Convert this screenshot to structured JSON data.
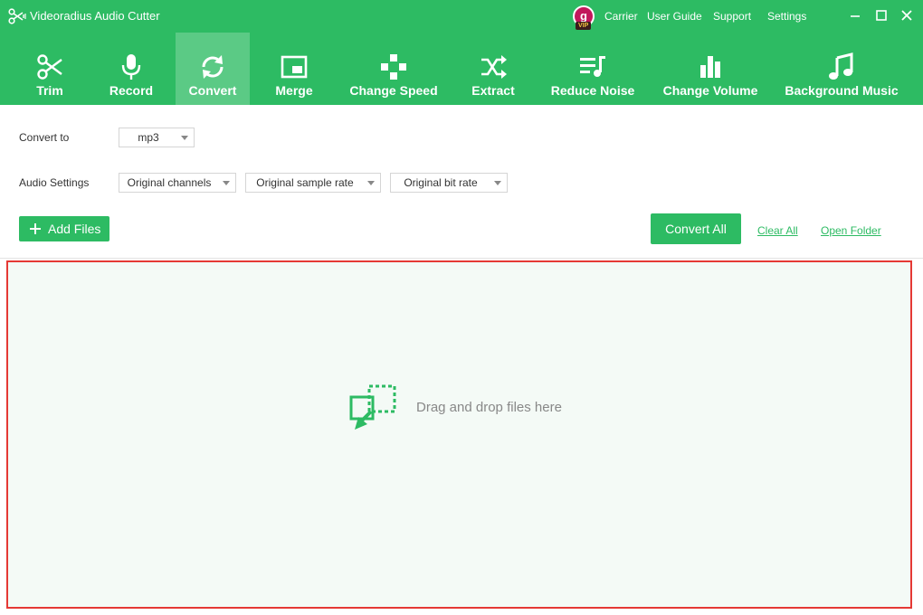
{
  "app": {
    "title": "Videoradius Audio Cutter"
  },
  "user": {
    "avatar_letter": "g",
    "badge": "VIP"
  },
  "top_links": [
    "Carrier",
    "User Guide",
    "Support",
    "Settings"
  ],
  "toolbar": {
    "items": [
      {
        "label": "Trim",
        "icon": "scissors-icon",
        "active": false
      },
      {
        "label": "Record",
        "icon": "microphone-icon",
        "active": false
      },
      {
        "label": "Convert",
        "icon": "convert-icon",
        "active": true
      },
      {
        "label": "Merge",
        "icon": "merge-icon",
        "active": false
      },
      {
        "label": "Change Speed",
        "icon": "speed-icon",
        "active": false
      },
      {
        "label": "Extract",
        "icon": "shuffle-icon",
        "active": false
      },
      {
        "label": "Reduce Noise",
        "icon": "noise-icon",
        "active": false
      },
      {
        "label": "Change Volume",
        "icon": "volume-bars-icon",
        "active": false
      },
      {
        "label": "Background Music",
        "icon": "music-note-icon",
        "active": false
      }
    ]
  },
  "settings": {
    "convert_to_label": "Convert to",
    "format": "mp3",
    "audio_settings_label": "Audio Settings",
    "channels": "Original channels",
    "sample_rate": "Original sample rate",
    "bit_rate": "Original bit rate"
  },
  "actions": {
    "add_files": "Add Files",
    "convert_all": "Convert All",
    "clear_all": "Clear All",
    "open_folder": "Open Folder"
  },
  "dropzone": {
    "text": "Drag and drop files here"
  },
  "colors": {
    "accent": "#2dbb63",
    "dropzone_border": "#e53935",
    "dropzone_bg": "#f4faf6"
  }
}
